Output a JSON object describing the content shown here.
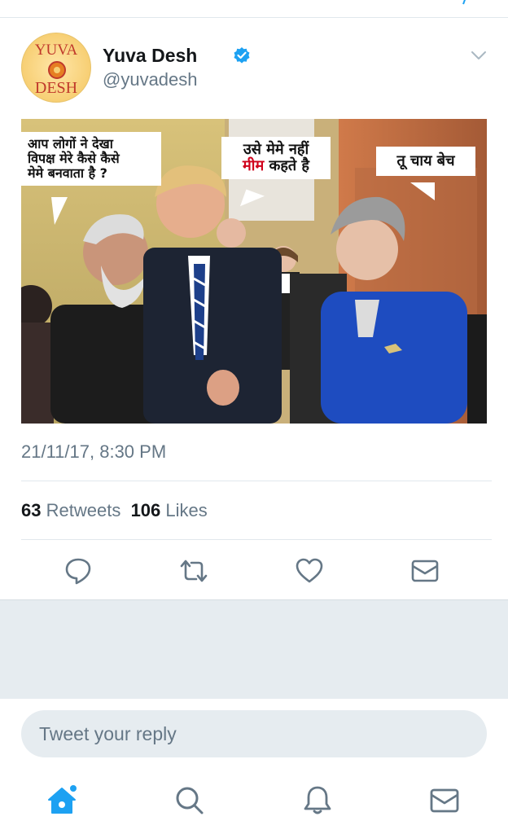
{
  "tweet": {
    "display_name": "Yuva Desh",
    "handle": "@yuvadesh",
    "verified": true,
    "avatar": {
      "text_top": "YUVA",
      "text_bottom": "DESH"
    },
    "timestamp": "21/11/17, 8:30 PM",
    "retweets_count": "63",
    "retweets_label": "Retweets",
    "likes_count": "106",
    "likes_label": "Likes"
  },
  "meme": {
    "bubble_left_line1": "आप लोगों ने देखा",
    "bubble_left_line2": "विपक्ष मेरे कैसे कैसे",
    "bubble_left_line3": "मेमे बनवाता है ?",
    "bubble_center_line1": "उसे मेमे नहीं",
    "bubble_center_red": "मीम",
    "bubble_center_rest": " कहते है",
    "bubble_right": "तू चाय बेच"
  },
  "reply": {
    "placeholder": "Tweet your reply"
  },
  "icons": {
    "verified": "verified-badge-icon",
    "menu": "chevron-down-icon",
    "reply": "reply-bubble-icon",
    "retweet": "retweet-icon",
    "like": "heart-icon",
    "dm": "envelope-icon",
    "home": "home-icon",
    "search": "search-icon",
    "notifications": "bell-icon",
    "messages": "envelope-icon"
  },
  "colors": {
    "accent": "#1da1f2",
    "muted": "#657786",
    "text": "#14171a",
    "divider": "#e1e8ed"
  }
}
